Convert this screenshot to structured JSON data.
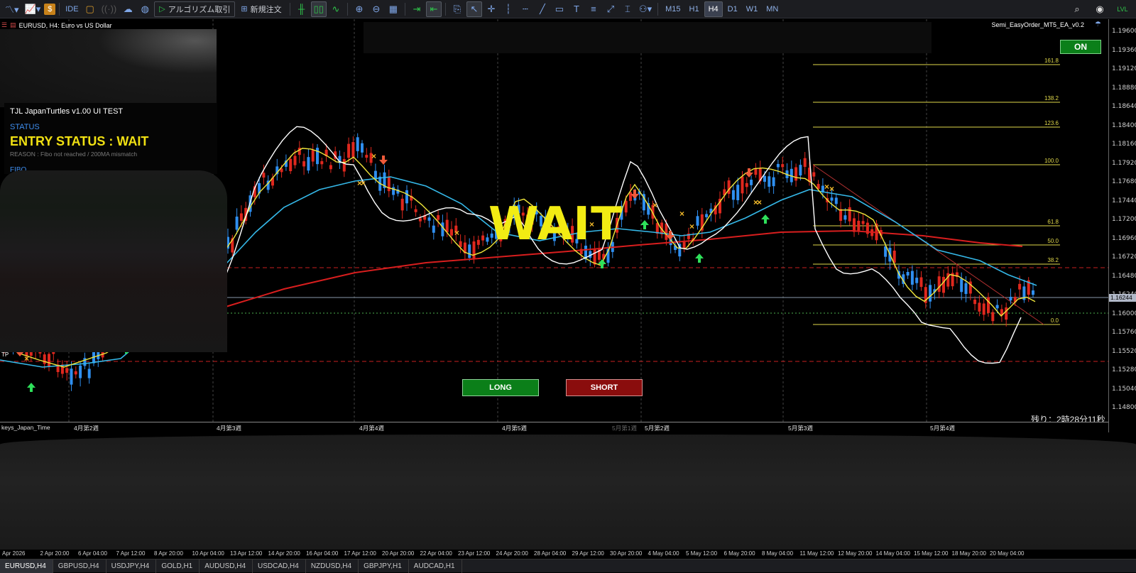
{
  "toolbar": {
    "algo_label": "アルゴリズム取引",
    "new_order_label": "新規注文",
    "ide_label": "IDE",
    "timeframes": [
      "M15",
      "H1",
      "H4",
      "D1",
      "W1",
      "MN"
    ],
    "active_timeframe": "H4"
  },
  "chart": {
    "symbol_title": "EURUSD, H4:  Euro vs US Dollar",
    "ea_title": "Semi_EasyOrder_MT5_EA_v0.2",
    "on_label": "ON",
    "wait_label": "WAIT",
    "long_label": "LONG",
    "short_label": "SHORT",
    "countdown": "残り：2時28分11秒",
    "tp_label": "TP",
    "current_price": "1.16244",
    "price_ticks": [
      "1.19600",
      "1.19360",
      "1.19120",
      "1.18880",
      "1.18640",
      "1.18400",
      "1.18160",
      "1.17920",
      "1.17680",
      "1.17440",
      "1.17200",
      "1.16960",
      "1.16720",
      "1.16480",
      "1.16240",
      "1.16000",
      "1.15760",
      "1.15520",
      "1.15280",
      "1.15040",
      "1.14800"
    ],
    "fib_levels": [
      "161.8",
      "138.2",
      "123.6",
      "100.0",
      "61.8",
      "50.0",
      "38.2",
      "0.0"
    ],
    "week_labels": [
      "keys_Japan_Time",
      "4月第2週",
      "4月第3週",
      "4月第4週",
      "4月第5週",
      "5月第1週",
      "5月第2週",
      "5月第3週",
      "5月第4週"
    ],
    "colors": {
      "bull": "#2f8ff0",
      "bear": "#e0281e",
      "ma_fast": "#f0e63a",
      "ma_mid": "#35b8e8",
      "ma_slow": "#d81e1e",
      "line_white": "#ffffff",
      "fib": "#e0d84a"
    }
  },
  "panel": {
    "title": "TJL JapanTurtles v1.00 UI TEST",
    "status_label": "STATUS",
    "entry_status": "ENTRY STATUS : WAIT",
    "reason": "REASON : Fibo not reached / 200MA mismatch",
    "fibo_label": "FIBO"
  },
  "date_axis": [
    "Apr 2026",
    "2 Apr 20:00",
    "6 Apr 04:00",
    "7 Apr 12:00",
    "8 Apr 20:00",
    "10 Apr 04:00",
    "13 Apr 12:00",
    "14 Apr 20:00",
    "16 Apr 04:00",
    "17 Apr 12:00",
    "20 Apr 20:00",
    "22 Apr 04:00",
    "23 Apr 12:00",
    "24 Apr 20:00",
    "28 Apr 04:00",
    "29 Apr 12:00",
    "30 Apr 20:00",
    "4 May 04:00",
    "5 May 12:00",
    "6 May 20:00",
    "8 May 04:00",
    "11 May 12:00",
    "12 May 20:00",
    "14 May 04:00",
    "15 May 12:00",
    "18 May 20:00",
    "20 May 04:00"
  ],
  "symbol_tabs": [
    "EURUSD,H4",
    "GBPUSD,H4",
    "USDJPY,H4",
    "GOLD,H1",
    "AUDUSD,H4",
    "USDCAD,H4",
    "NZDUSD,H4",
    "GBPJPY,H1",
    "AUDCAD,H1"
  ]
}
